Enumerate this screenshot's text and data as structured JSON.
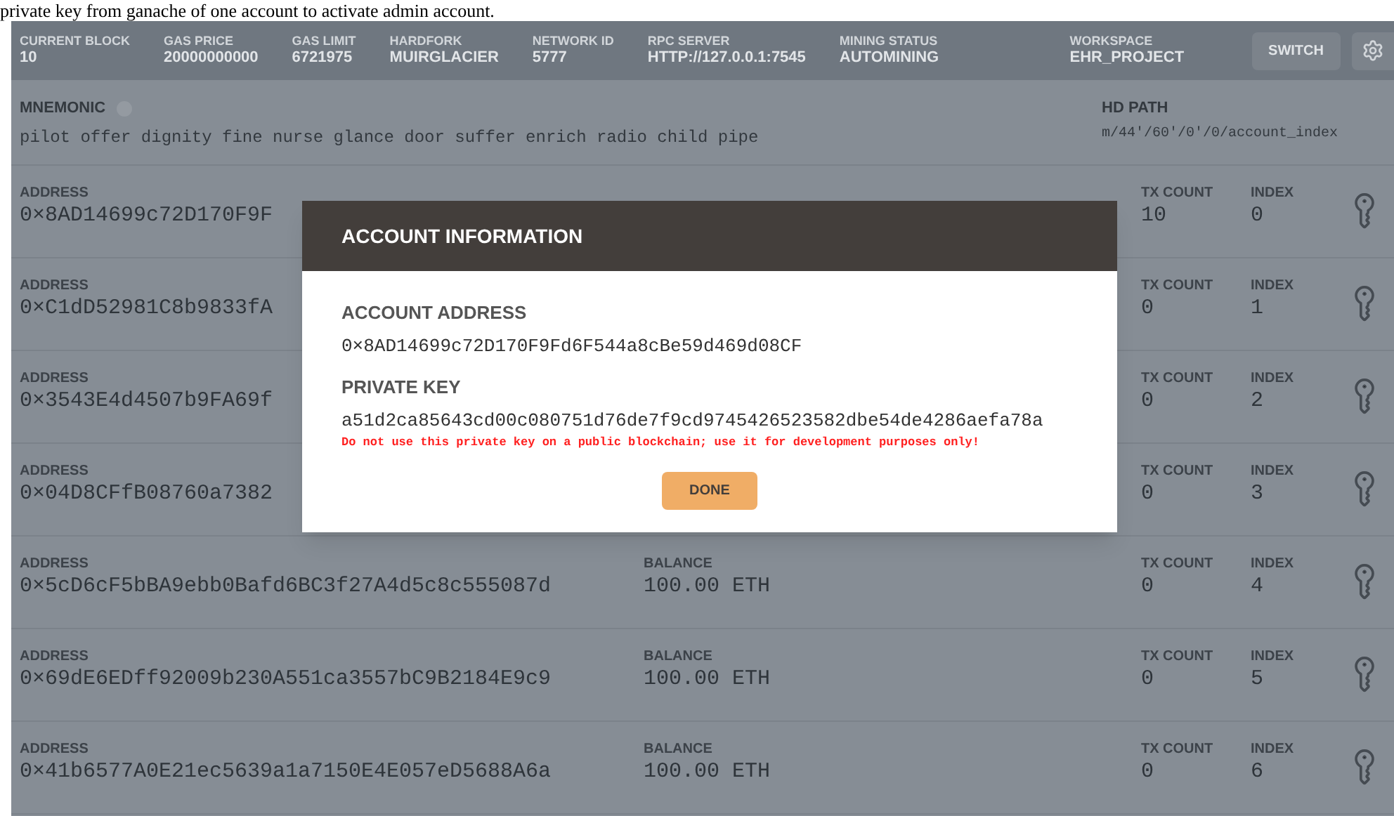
{
  "document_text": "private key from ganache of one account to activate admin account.",
  "header": {
    "stats": [
      {
        "label": "CURRENT BLOCK",
        "value": "10"
      },
      {
        "label": "GAS PRICE",
        "value": "20000000000"
      },
      {
        "label": "GAS LIMIT",
        "value": "6721975"
      },
      {
        "label": "HARDFORK",
        "value": "MUIRGLACIER"
      },
      {
        "label": "NETWORK ID",
        "value": "5777"
      },
      {
        "label": "RPC SERVER",
        "value": "HTTP://127.0.0.1:7545"
      },
      {
        "label": "MINING STATUS",
        "value": "AUTOMINING"
      }
    ],
    "workspace": {
      "label": "WORKSPACE",
      "value": "EHR_PROJECT"
    },
    "switch_button": "SWITCH"
  },
  "mnemonic": {
    "label": "MNEMONIC",
    "value": "pilot offer dignity fine nurse glance door suffer enrich radio child pipe"
  },
  "hd_path": {
    "label": "HD PATH",
    "value": "m/44'/60'/0'/0/account_index"
  },
  "accounts": [
    {
      "address_label": "ADDRESS",
      "address": "0×8AD14699c72D170F9F",
      "tx_label": "TX COUNT",
      "tx_count": "10",
      "index_label": "INDEX",
      "index": "0"
    },
    {
      "address_label": "ADDRESS",
      "address": "0×C1dD52981C8b9833fA",
      "tx_label": "TX COUNT",
      "tx_count": "0",
      "index_label": "INDEX",
      "index": "1"
    },
    {
      "address_label": "ADDRESS",
      "address": "0×3543E4d4507b9FA69f",
      "tx_label": "TX COUNT",
      "tx_count": "0",
      "index_label": "INDEX",
      "index": "2"
    },
    {
      "address_label": "ADDRESS",
      "address": "0×04D8CFfB08760a7382",
      "tx_label": "TX COUNT",
      "tx_count": "0",
      "index_label": "INDEX",
      "index": "3"
    },
    {
      "address_label": "ADDRESS",
      "address": "0×5cD6cF5bBA9ebb0Bafd6BC3f27A4d5c8c555087d",
      "balance_label": "BALANCE",
      "balance": "100.00 ETH",
      "tx_label": "TX COUNT",
      "tx_count": "0",
      "index_label": "INDEX",
      "index": "4"
    },
    {
      "address_label": "ADDRESS",
      "address": "0×69dE6EDff92009b230A551ca3557bC9B2184E9c9",
      "balance_label": "BALANCE",
      "balance": "100.00 ETH",
      "tx_label": "TX COUNT",
      "tx_count": "0",
      "index_label": "INDEX",
      "index": "5"
    },
    {
      "address_label": "ADDRESS",
      "address": "0×41b6577A0E21ec5639a1a7150E4E057eD5688A6a",
      "balance_label": "BALANCE",
      "balance": "100.00 ETH",
      "tx_label": "TX COUNT",
      "tx_count": "0",
      "index_label": "INDEX",
      "index": "6"
    }
  ],
  "dialog": {
    "title": "ACCOUNT INFORMATION",
    "address_label": "ACCOUNT ADDRESS",
    "address": "0×8AD14699c72D170F9Fd6F544a8cBe59d469d08CF",
    "key_label": "PRIVATE KEY",
    "private_key": "a51d2ca85643cd00c080751d76de7f9cd9745426523582dbe54de4286aefa78a",
    "warning": "Do not use this private key on a public blockchain; use it for development purposes only!",
    "done_button": "DONE"
  }
}
